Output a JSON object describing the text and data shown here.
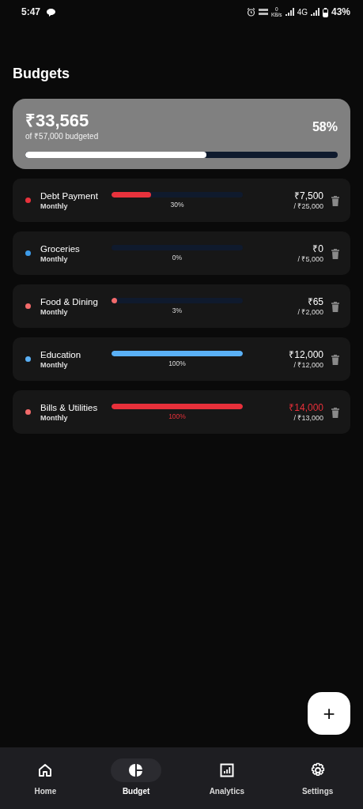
{
  "status_bar": {
    "time": "5:47",
    "data_speed": "0",
    "data_unit": "KB/s",
    "network": "4G",
    "battery": "43%"
  },
  "title": "Budgets",
  "summary": {
    "spent": "₹33,565",
    "caption": "of ₹57,000 budgeted",
    "percent": "58%",
    "level": 0.58
  },
  "budgets": [
    {
      "name": "Debt Payment",
      "period": "Monthly",
      "color": "#e8323c",
      "level": 0.3,
      "percent": "30%",
      "spent": "₹7,500",
      "limit": "/ ₹25,000",
      "over": false
    },
    {
      "name": "Groceries",
      "period": "Monthly",
      "color": "#3d9be9",
      "level": 0,
      "percent": "0%",
      "spent": "₹0",
      "limit": "/ ₹5,000",
      "over": false
    },
    {
      "name": "Food & Dining",
      "period": "Monthly",
      "color": "#f26a6a",
      "level": 0.03,
      "percent": "3%",
      "spent": "₹65",
      "limit": "/ ₹2,000",
      "over": false
    },
    {
      "name": "Education",
      "period": "Monthly",
      "color": "#5ab0f5",
      "level": 1,
      "percent": "100%",
      "spent": "₹12,000",
      "limit": "/ ₹12,000",
      "over": false
    },
    {
      "name": "Bills & Utilities",
      "period": "Monthly",
      "color": "#f26a6a",
      "level": 1,
      "percent": "100%",
      "spent": "₹14,000",
      "limit": "/ ₹13,000",
      "over": true
    }
  ],
  "fab": "+",
  "nav": [
    {
      "kind": "home",
      "label": "Home",
      "selected": false
    },
    {
      "kind": "budget",
      "label": "Budget",
      "selected": true
    },
    {
      "kind": "analytics",
      "label": "Analytics",
      "selected": false
    },
    {
      "kind": "settings",
      "label": "Settings",
      "selected": false
    }
  ]
}
